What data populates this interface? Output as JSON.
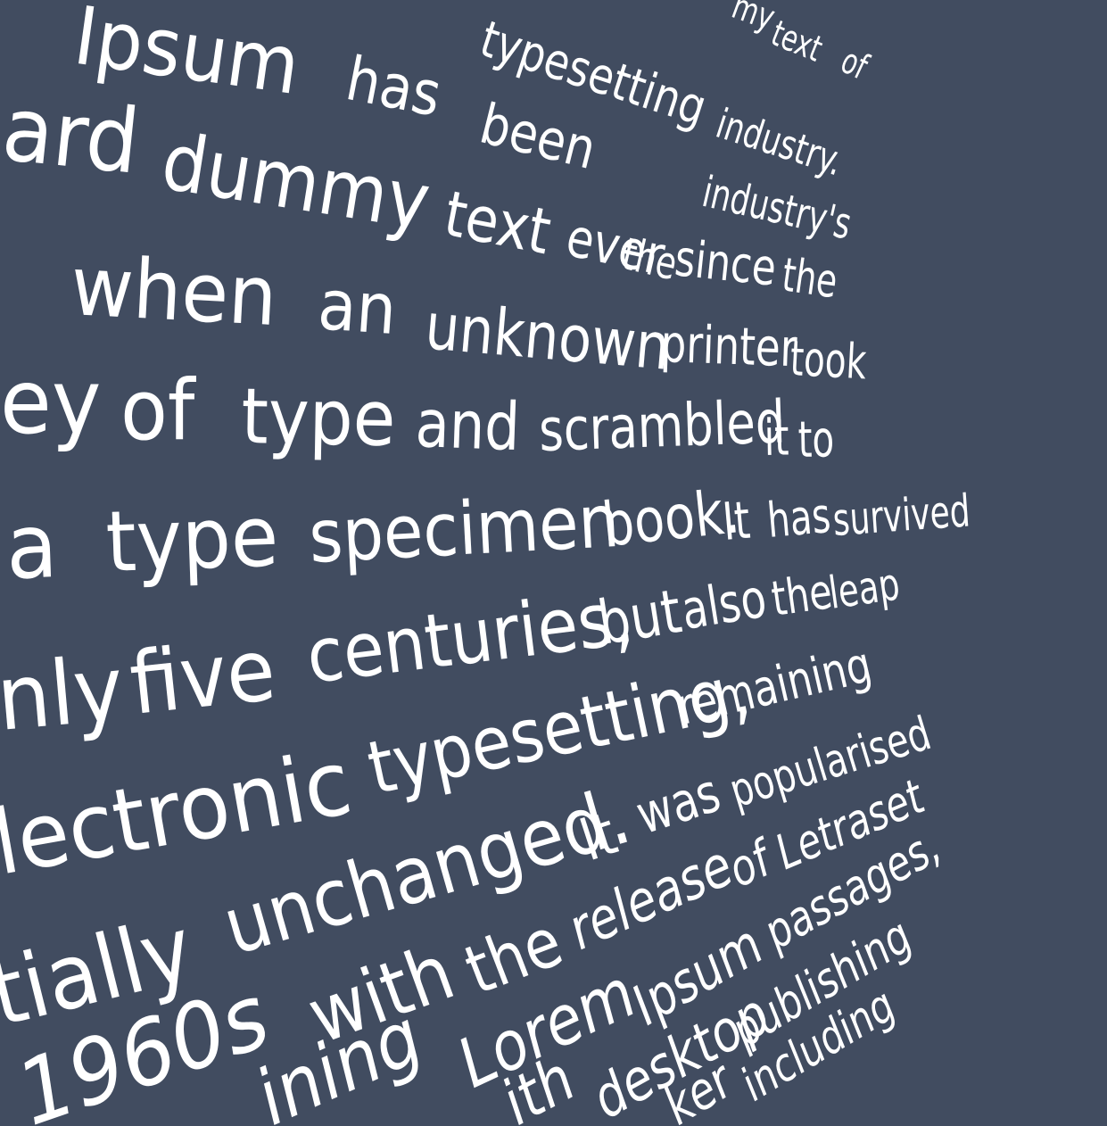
{
  "background_color": "#414c60",
  "text_color": "#ffffff",
  "lines": [
    [
      "my",
      "text",
      "of"
    ],
    [
      "Ipsum",
      "has",
      "been",
      "typesetting",
      "industry."
    ],
    [
      "ard",
      "dummy",
      "text",
      "ever",
      "the",
      "industry's"
    ],
    [
      "when",
      "an",
      "unknown",
      "since",
      "the"
    ],
    [
      "ey",
      "of",
      "type",
      "and",
      "printer",
      "took"
    ],
    [
      "a",
      "type",
      "specimen",
      "scrambled",
      "it",
      "to"
    ],
    [
      "nly",
      "five",
      "centuries,",
      "book.",
      "It",
      "has",
      "survived"
    ],
    [
      "lectronic",
      "typesetting,",
      "but",
      "also",
      "the",
      "leap"
    ],
    [
      "tially",
      "unchanged.",
      "remaining"
    ],
    [
      "1960s",
      "with",
      "the",
      "It",
      "was",
      "popularised"
    ],
    [
      "ining",
      "Lorem",
      "release",
      "of",
      "Letraset"
    ],
    [
      "ith",
      "desktop",
      "Ipsum",
      "passages,"
    ],
    [
      "ker",
      "including",
      "publishing"
    ]
  ]
}
